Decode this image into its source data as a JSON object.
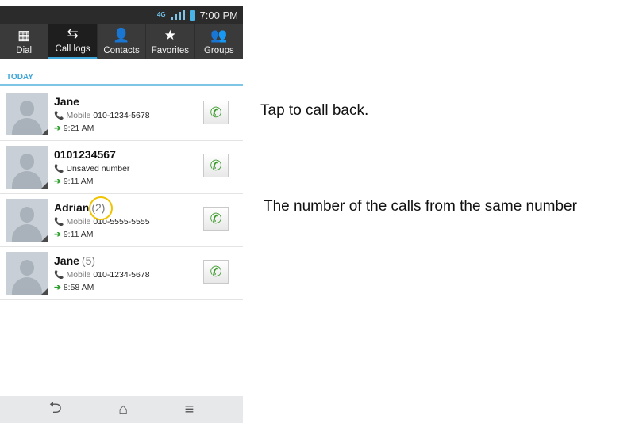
{
  "status_bar": {
    "time": "7:00 PM",
    "network": "4G",
    "icons": [
      "signal-icon",
      "battery-icon"
    ]
  },
  "tabs": [
    {
      "label": "Dial",
      "icon": "keypad-icon",
      "glyph": "▦",
      "active": false
    },
    {
      "label": "Call logs",
      "icon": "call-logs-icon",
      "glyph": "⇆",
      "active": true
    },
    {
      "label": "Contacts",
      "icon": "person-icon",
      "glyph": "👤",
      "active": false
    },
    {
      "label": "Favorites",
      "icon": "star-icon",
      "glyph": "★",
      "active": false
    },
    {
      "label": "Groups",
      "icon": "group-icon",
      "glyph": "👥",
      "active": false
    }
  ],
  "section_label": "TODAY",
  "calls": [
    {
      "name": "Jane",
      "count": "",
      "type": "Mobile",
      "number": "010-1234-5678",
      "time": "9:21 AM"
    },
    {
      "name": "0101234567",
      "count": "",
      "type": "Unsaved number",
      "number": "",
      "time": "9:11 AM"
    },
    {
      "name": "Adrian",
      "count": "(2)",
      "type": "Mobile",
      "number": "010-5555-5555",
      "time": "9:11 AM"
    },
    {
      "name": "Jane",
      "count": "(5)",
      "type": "Mobile",
      "number": "010-1234-5678",
      "time": "8:58 AM"
    }
  ],
  "annotations": {
    "call_back": "Tap to call back.",
    "call_count": "The number of the calls from the same number"
  },
  "nav": {
    "back_glyph": "⮌",
    "home_glyph": "⌂",
    "menu_glyph": "≡"
  }
}
